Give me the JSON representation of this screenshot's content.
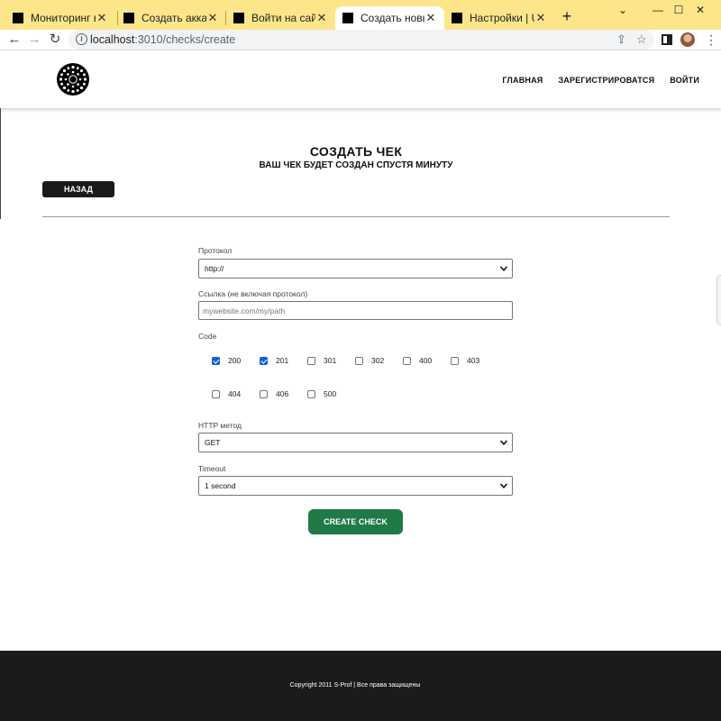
{
  "browser": {
    "tabs": [
      {
        "title": "Мониторинг време",
        "active": false
      },
      {
        "title": "Создать аккаунт | Up",
        "active": false
      },
      {
        "title": "Войти на сайт | Upt",
        "active": false
      },
      {
        "title": "Создать новый чек",
        "active": true
      },
      {
        "title": "Настройки | Uptime",
        "active": false
      }
    ],
    "url_host": "localhost",
    "url_path": ":3010/checks/create",
    "window_controls": {
      "chevron": "⌄",
      "minimize": "—",
      "maximize": "☐",
      "close": "✕"
    }
  },
  "header": {
    "nav": [
      "ГЛАВНАЯ",
      "ЗАРЕГИСТРИРОВАТСЯ",
      "ВОЙТИ"
    ]
  },
  "main": {
    "title": "СОЗДАТЬ ЧЕК",
    "subtitle": "ВАШ ЧЕК БУДЕТ СОЗДАН СПУСТЯ МИНУТУ",
    "back_label": "НАЗАД"
  },
  "form": {
    "protocol_label": "Протокол",
    "protocol_value": "http://",
    "link_label": "Ссылка (не включая протокол)",
    "link_placeholder": "mywebsite.com/my/path",
    "code_label": "Code",
    "codes": [
      {
        "code": "200",
        "checked": true
      },
      {
        "code": "201",
        "checked": true
      },
      {
        "code": "301",
        "checked": false
      },
      {
        "code": "302",
        "checked": false
      },
      {
        "code": "400",
        "checked": false
      },
      {
        "code": "403",
        "checked": false
      },
      {
        "code": "404",
        "checked": false
      },
      {
        "code": "406",
        "checked": false
      },
      {
        "code": "500",
        "checked": false
      }
    ],
    "method_label": "HTTP метод",
    "method_value": "GET",
    "timeout_label": "Timeout",
    "timeout_value": "1 second",
    "submit_label": "CREATE CHECK"
  },
  "footer": {
    "text": "Copyright 2011 S-Prof | Все права защищены"
  },
  "colors": {
    "tabbar": "#fde68a",
    "accent_green": "#1f7a46",
    "checkbox_blue": "#0b62d6",
    "footer_bg": "#1b1b1b"
  }
}
